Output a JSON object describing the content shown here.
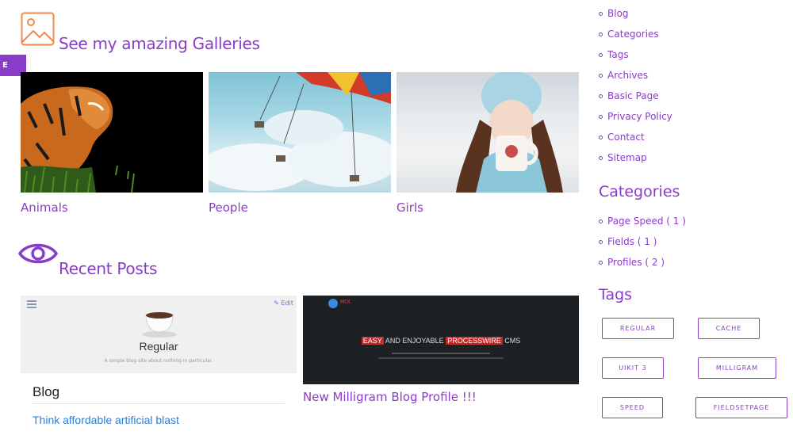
{
  "edit_tab": {
    "label": "E"
  },
  "galleries": {
    "title": "See my amazing Galleries",
    "items": [
      {
        "label": "Animals"
      },
      {
        "label": "People"
      },
      {
        "label": "Girls"
      }
    ]
  },
  "recent_posts": {
    "title": "Recent Posts",
    "post1": {
      "edit_label": "Edit",
      "site_title": "Regular",
      "tagline": "A simple blog site about nothing in particular.",
      "blog_heading": "Blog",
      "post_title": "Think affordable artificial blast"
    },
    "post2": {
      "brand": "MIX",
      "headline_a": "EASY",
      "headline_b": "AND ENJOYABLE",
      "headline_c": "PROCESSWIRE",
      "headline_d": "CMS",
      "caption": "New Milligram Blog Profile !!!"
    }
  },
  "sidebar": {
    "nav": [
      {
        "label": "Blog"
      },
      {
        "label": "Categories"
      },
      {
        "label": "Tags"
      },
      {
        "label": "Archives"
      },
      {
        "label": "Basic Page"
      },
      {
        "label": "Privacy Policy"
      },
      {
        "label": "Contact"
      },
      {
        "label": "Sitemap"
      }
    ],
    "categories_heading": "Categories",
    "categories": [
      {
        "label": "Page Speed ( 1 )"
      },
      {
        "label": "Fields ( 1 )"
      },
      {
        "label": "Profiles ( 2 )"
      }
    ],
    "tags_heading": "Tags",
    "tags": [
      {
        "label": "REGULAR"
      },
      {
        "label": "CACHE"
      },
      {
        "label": "UIKIT 3"
      },
      {
        "label": "MILLIGRAM"
      },
      {
        "label": "SPEED"
      },
      {
        "label": "FIELDSETPAGE"
      }
    ]
  },
  "colors": {
    "accent": "#8a3cc8",
    "icon_orange": "#f08a4b"
  },
  "icons": {
    "gallery": "image-icon",
    "recent": "eye-icon",
    "menu": "hamburger-icon"
  }
}
